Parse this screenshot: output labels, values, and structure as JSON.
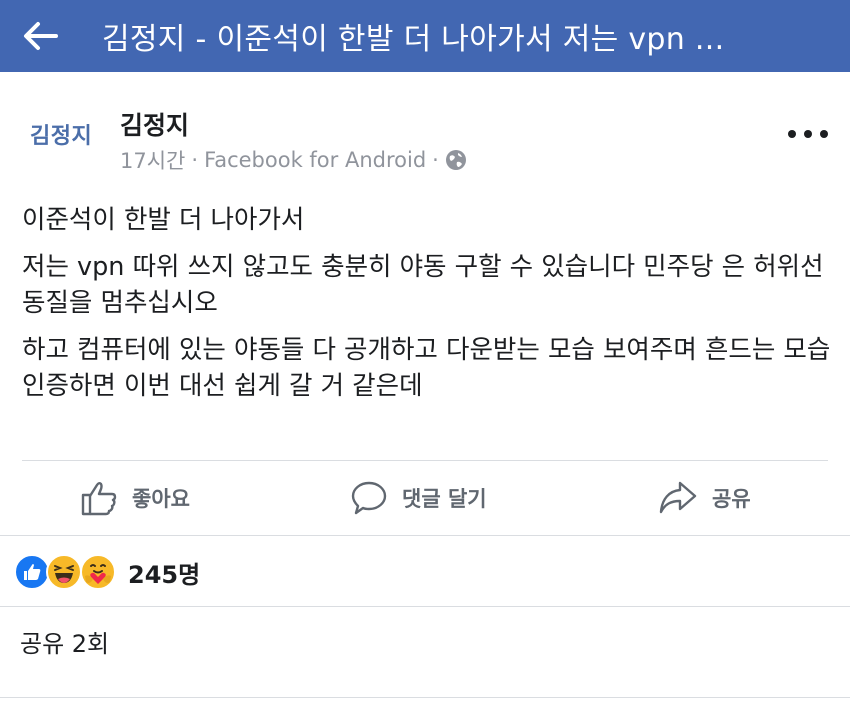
{
  "topbar": {
    "title": "김정지 - 이준석이 한발 더 나아가서 저는 vpn ...",
    "back_icon": "back-arrow-icon",
    "background": "#4267b2"
  },
  "post": {
    "avatar_text": "김정지",
    "author": "김정지",
    "time": "17시간",
    "separator": "·",
    "source": "Facebook for Android",
    "privacy_icon": "globe-icon",
    "paragraphs": [
      "이준석이 한발 더 나아가서",
      "저는 vpn 따위 쓰지 않고도 충분히 야동 구할 수 있습니다 민주당 은 허위선동질을 멈추십시오",
      "하고 컴퓨터에 있는 야동들 다 공개하고 다운받는 모습 보여주며 흔드는 모습 인증하면 이번 대선 쉽게 갈 거 같은데"
    ]
  },
  "actions": {
    "like": "좋아요",
    "comment": "댓글 달기",
    "share": "공유"
  },
  "reactions": {
    "icons": [
      "like-reaction-icon",
      "haha-reaction-icon",
      "care-reaction-icon"
    ],
    "count": "245명"
  },
  "shares": {
    "text": "공유 2회"
  },
  "colors": {
    "brand_blue": "#4267b2",
    "secondary_text": "#90949c",
    "action_text": "#606770",
    "divider": "#dadde1"
  }
}
